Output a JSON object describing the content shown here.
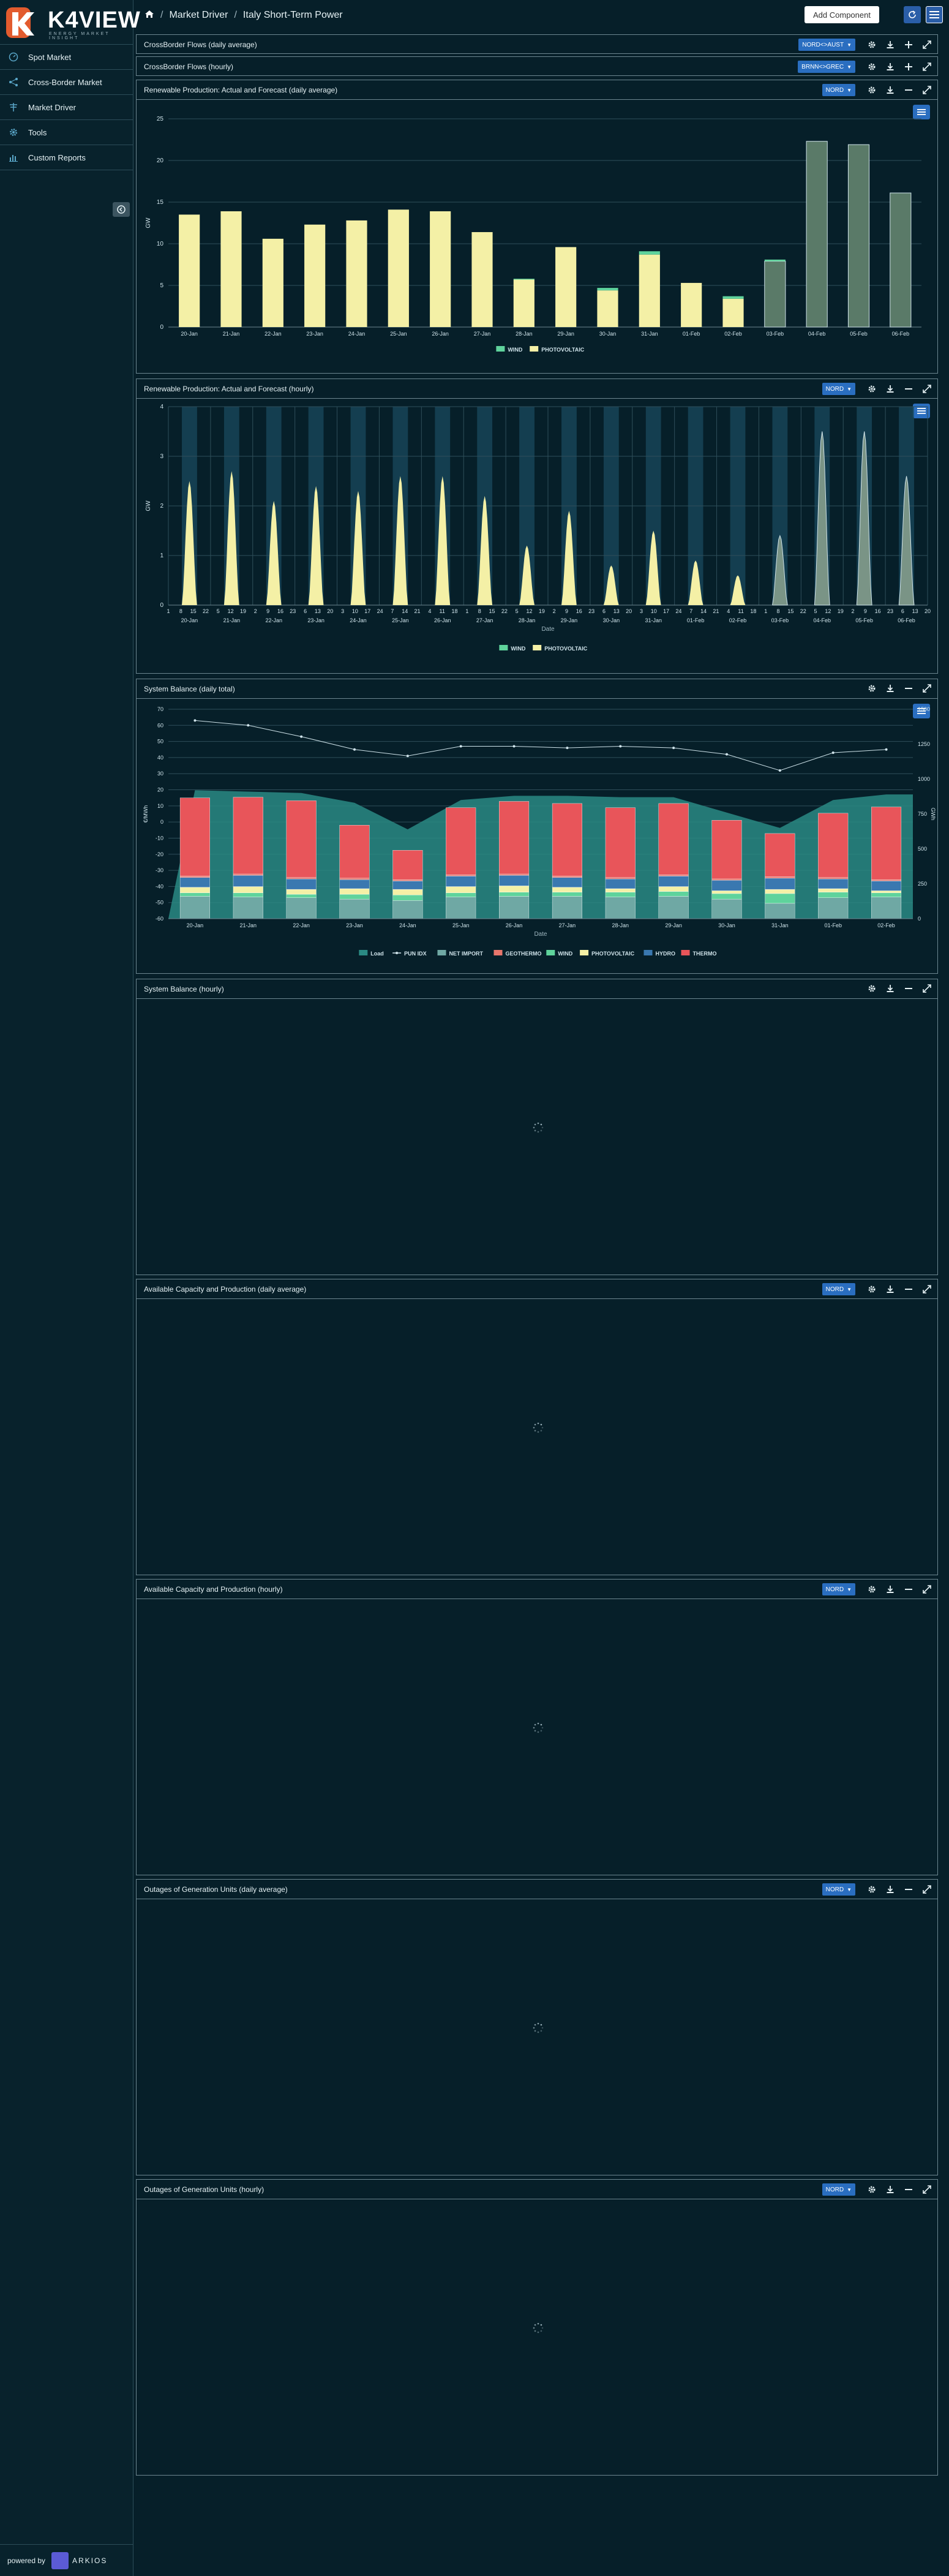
{
  "app": {
    "logo_text": "K4VIEW",
    "logo_tagline": "ENERGY MARKET INSIGHT",
    "powered_label": "powered by",
    "powered_brand": "ARKIOS"
  },
  "sidebar": {
    "items": [
      {
        "label": "Spot Market",
        "icon": "dial-icon"
      },
      {
        "label": "Cross-Border Market",
        "icon": "share-icon"
      },
      {
        "label": "Market Driver",
        "icon": "tower-icon"
      },
      {
        "label": "Tools",
        "icon": "gear-icon"
      },
      {
        "label": "Custom Reports",
        "icon": "bar-chart-icon"
      }
    ]
  },
  "topbar": {
    "breadcrumb": [
      "Market Driver",
      "Italy Short-Term Power"
    ],
    "add_component": "Add Component"
  },
  "panels": [
    {
      "title": "CrossBorder Flows (daily average)",
      "zone": "NORD<>AUST",
      "state": "collapsed"
    },
    {
      "title": "CrossBorder Flows (hourly)",
      "zone": "BRNN<>GREC",
      "state": "collapsed"
    },
    {
      "title": "Renewable Production: Actual and Forecast (daily average)",
      "zone": "NORD",
      "state": "chart"
    },
    {
      "title": "Renewable Production: Actual and Forecast (hourly)",
      "zone": "NORD",
      "state": "chart"
    },
    {
      "title": "System Balance (daily total)",
      "zone": "",
      "state": "chart"
    },
    {
      "title": "System Balance (hourly)",
      "zone": "",
      "state": "loading"
    },
    {
      "title": "Available Capacity and Production (daily average)",
      "zone": "NORD",
      "state": "loading"
    },
    {
      "title": "Available Capacity and Production (hourly)",
      "zone": "NORD",
      "state": "loading"
    },
    {
      "title": "Outages of Generation Units (daily average)",
      "zone": "NORD",
      "state": "loading"
    },
    {
      "title": "Outages of Generation Units (hourly)",
      "zone": "NORD",
      "state": "loading"
    }
  ],
  "colors": {
    "wind": "#5fd39c",
    "photovoltaic": "#f4f0a6",
    "forecast_fill": "#5a7a68",
    "load": "#2a8a84",
    "net_import": "#6fa8a4",
    "geothermo": "#e8766c",
    "hydro": "#3a78b0",
    "thermo": "#e8555a",
    "pun": "#cfe3ea"
  },
  "chart_data": [
    {
      "type": "bar",
      "title": "",
      "ylabel": "GW",
      "ylim": [
        0,
        25
      ],
      "yticks": [
        "0",
        "5",
        "10",
        "15",
        "20",
        "25"
      ],
      "categories": [
        "20-Jan",
        "21-Jan",
        "22-Jan",
        "23-Jan",
        "24-Jan",
        "25-Jan",
        "26-Jan",
        "27-Jan",
        "28-Jan",
        "29-Jan",
        "30-Jan",
        "31-Jan",
        "01-Feb",
        "02-Feb",
        "03-Feb",
        "04-Feb",
        "05-Feb",
        "06-Feb"
      ],
      "series": [
        {
          "name": "WIND",
          "values": [
            0,
            0,
            0,
            0,
            0,
            0,
            0,
            0,
            0.1,
            0,
            0.3,
            0.4,
            0,
            0.3,
            0.2,
            0,
            0,
            0
          ]
        },
        {
          "name": "PHOTOVOLTAIC",
          "values": [
            13.5,
            13.9,
            10.6,
            12.3,
            12.8,
            14.1,
            13.9,
            11.4,
            5.7,
            9.6,
            4.4,
            8.7,
            5.3,
            3.4,
            7.9,
            22.3,
            21.9,
            16.1
          ]
        }
      ],
      "forecast_from_index": 14,
      "legend": [
        "WIND",
        "PHOTOVOLTAIC"
      ],
      "legend_position": "bottom",
      "grid": true
    },
    {
      "type": "area",
      "title": "",
      "ylabel": "GW",
      "xlabel": "Date",
      "ylim": [
        0,
        4
      ],
      "yticks": [
        "0",
        "1",
        "2",
        "3",
        "4"
      ],
      "categories": [
        "20-Jan",
        "21-Jan",
        "22-Jan",
        "23-Jan",
        "24-Jan",
        "25-Jan",
        "26-Jan",
        "27-Jan",
        "28-Jan",
        "29-Jan",
        "30-Jan",
        "31-Jan",
        "01-Feb",
        "02-Feb",
        "03-Feb",
        "04-Feb",
        "05-Feb",
        "06-Feb"
      ],
      "hour_ticks": [
        "1",
        "8",
        "15",
        "22",
        "5",
        "12",
        "19",
        "2",
        "9",
        "16",
        "23",
        "6",
        "13",
        "20",
        "3",
        "10",
        "17",
        "24",
        "7",
        "14",
        "21",
        "4",
        "11",
        "18",
        "1",
        "8",
        "15",
        "22",
        "5",
        "12",
        "19",
        "2",
        "9",
        "16",
        "23",
        "6",
        "13",
        "20",
        "3",
        "10",
        "17",
        "24",
        "7",
        "14",
        "21",
        "4",
        "11",
        "18",
        "1",
        "8",
        "15",
        "22",
        "5",
        "12",
        "19",
        "2",
        "9",
        "16",
        "23",
        "6",
        "13",
        "20"
      ],
      "series": [
        {
          "name": "PHOTOVOLTAIC",
          "daily_peaks": [
            2.5,
            2.7,
            2.1,
            2.4,
            2.3,
            2.6,
            2.6,
            2.2,
            1.2,
            1.9,
            0.8,
            1.5,
            0.9,
            0.6,
            1.4,
            3.5,
            3.5,
            2.6
          ]
        },
        {
          "name": "WIND",
          "daily_peaks": [
            0,
            0,
            0,
            0,
            0,
            0,
            0,
            0,
            0,
            0,
            0,
            0,
            0,
            0,
            0.1,
            0,
            0,
            0
          ]
        }
      ],
      "forecast_from_index": 14,
      "legend": [
        "WIND",
        "PHOTOVOLTAIC"
      ],
      "legend_position": "bottom",
      "grid": true
    },
    {
      "type": "bar",
      "title": "",
      "ylabel": "€/MWh",
      "y2label": "GWh",
      "xlabel": "Date",
      "ylim": [
        -60,
        70
      ],
      "y2lim": [
        0,
        1500
      ],
      "yticks": [
        "-60",
        "-50",
        "-40",
        "-30",
        "-20",
        "-10",
        "0",
        "10",
        "20",
        "30",
        "40",
        "50",
        "60",
        "70"
      ],
      "y2ticks": [
        "0",
        "250",
        "500",
        "750",
        "1000",
        "1250",
        "1500"
      ],
      "categories": [
        "20-Jan",
        "21-Jan",
        "22-Jan",
        "23-Jan",
        "24-Jan",
        "25-Jan",
        "26-Jan",
        "27-Jan",
        "28-Jan",
        "29-Jan",
        "30-Jan",
        "31-Jan",
        "01-Feb",
        "02-Feb"
      ],
      "series": [
        {
          "name": "THERMO",
          "values": [
            560,
            550,
            550,
            380,
            210,
            480,
            520,
            520,
            500,
            510,
            420,
            310,
            460,
            520
          ]
        },
        {
          "name": "GEOTHERMO",
          "values": [
            10,
            10,
            10,
            10,
            10,
            10,
            10,
            10,
            10,
            10,
            10,
            10,
            10,
            10
          ]
        },
        {
          "name": "HYDRO",
          "values": [
            70,
            80,
            75,
            65,
            60,
            75,
            75,
            70,
            70,
            75,
            75,
            80,
            70,
            70
          ]
        },
        {
          "name": "PHOTOVOLTAIC",
          "values": [
            40,
            45,
            35,
            40,
            40,
            45,
            45,
            35,
            25,
            35,
            20,
            30,
            25,
            15
          ]
        },
        {
          "name": "WIND",
          "values": [
            25,
            30,
            25,
            35,
            40,
            30,
            30,
            30,
            35,
            35,
            40,
            70,
            40,
            30
          ]
        },
        {
          "name": "NET IMPORT",
          "values": [
            160,
            155,
            150,
            140,
            130,
            155,
            160,
            160,
            155,
            160,
            140,
            110,
            150,
            155
          ]
        },
        {
          "name": "Load",
          "values": [
            920,
            910,
            900,
            830,
            640,
            850,
            880,
            880,
            870,
            870,
            760,
            650,
            850,
            890
          ]
        }
      ],
      "line_series": {
        "name": "PUN IDX",
        "values": [
          63,
          60,
          53,
          45,
          41,
          47,
          47,
          46,
          47,
          46,
          42,
          32,
          43,
          45
        ]
      },
      "legend": [
        "Load",
        "PUN IDX",
        "NET IMPORT",
        "GEOTHERMO",
        "WIND",
        "PHOTOVOLTAIC",
        "HYDRO",
        "THERMO"
      ],
      "legend_position": "bottom",
      "grid": true
    }
  ]
}
